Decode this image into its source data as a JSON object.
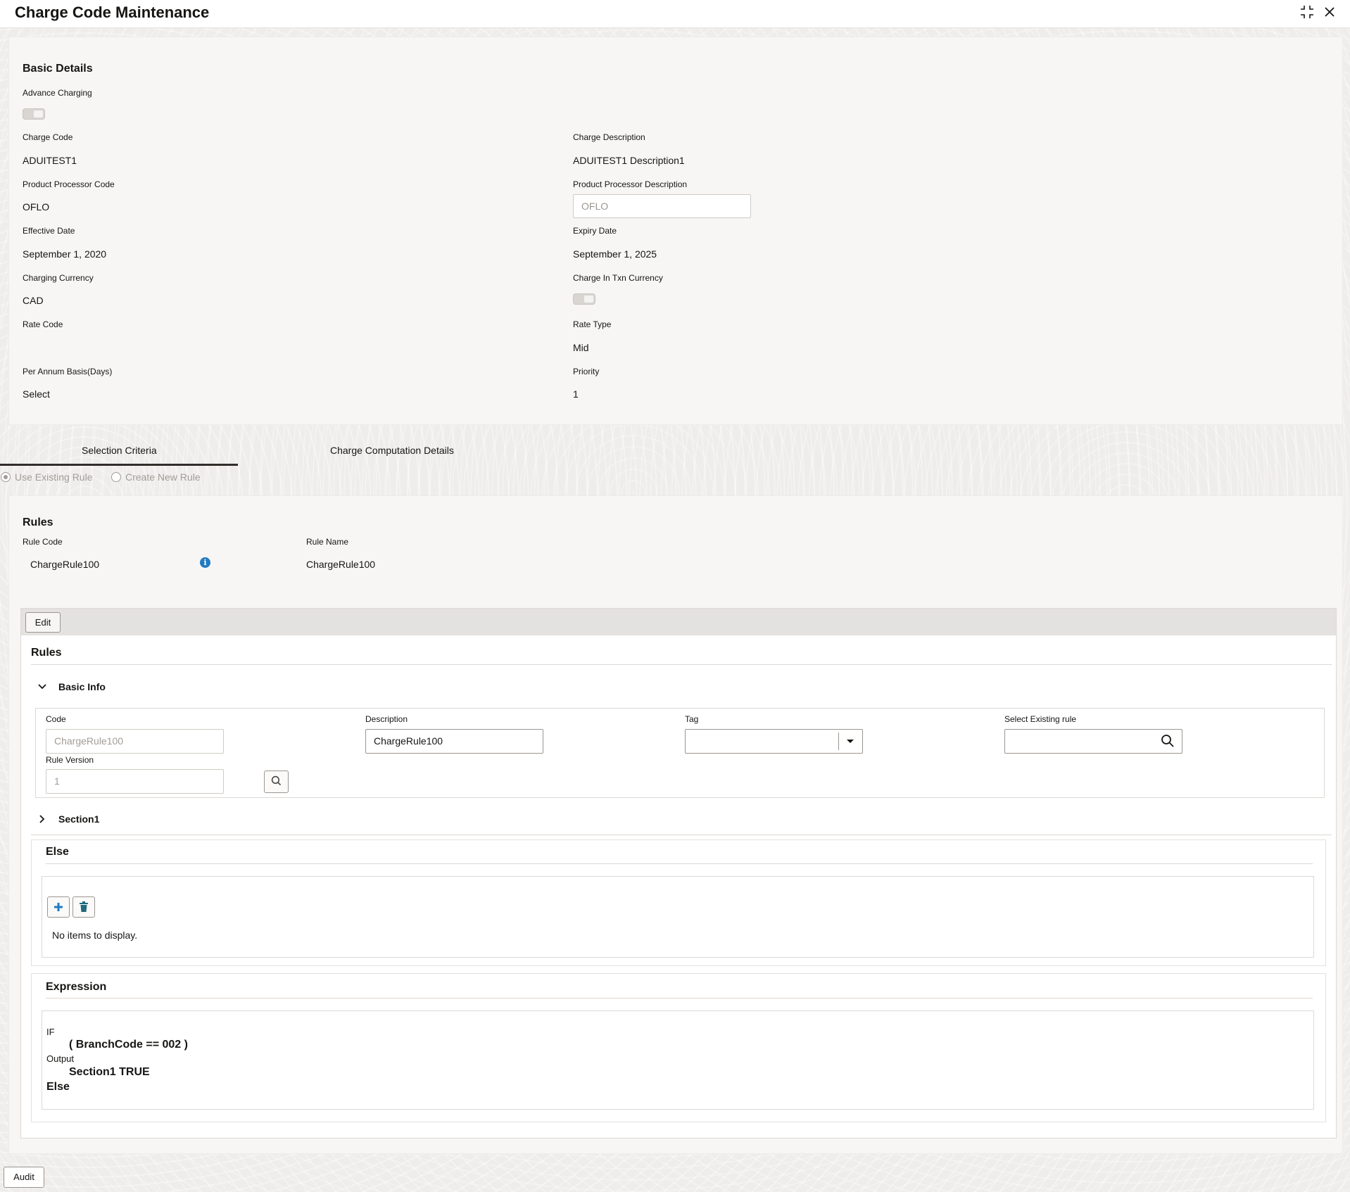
{
  "header": {
    "title": "Charge Code Maintenance",
    "minimize_icon": "collapse-icon",
    "close_icon": "close-icon"
  },
  "basic_details": {
    "title": "Basic Details",
    "advance_charging_label": "Advance Charging",
    "advance_charging_on": false,
    "charge_code_label": "Charge Code",
    "charge_code": "ADUITEST1",
    "charge_description_label": "Charge Description",
    "charge_description": "ADUITEST1 Description1",
    "product_processor_code_label": "Product Processor Code",
    "product_processor_code": "OFLO",
    "product_processor_description_label": "Product Processor Description",
    "product_processor_description": "OFLO",
    "effective_date_label": "Effective Date",
    "effective_date": "September 1, 2020",
    "expiry_date_label": "Expiry Date",
    "expiry_date": "September 1, 2025",
    "charging_currency_label": "Charging Currency",
    "charging_currency": "CAD",
    "charge_in_txn_currency_label": "Charge In Txn Currency",
    "charge_in_txn_currency_on": false,
    "rate_code_label": "Rate Code",
    "rate_code": "",
    "rate_type_label": "Rate Type",
    "rate_type": "Mid",
    "per_annum_basis_label": "Per Annum Basis(Days)",
    "per_annum_basis": "Select",
    "priority_label": "Priority",
    "priority": "1"
  },
  "tabs": [
    {
      "label": "Selection Criteria",
      "active": true
    },
    {
      "label": "Charge Computation Details",
      "active": false
    }
  ],
  "rule_mode": {
    "use_existing_label": "Use Existing Rule",
    "create_new_label": "Create New Rule",
    "selected": "use_existing"
  },
  "rules": {
    "title": "Rules",
    "rule_code_label": "Rule Code",
    "rule_code": "ChargeRule100",
    "rule_name_label": "Rule Name",
    "rule_name": "ChargeRule100",
    "info_icon": "info-icon"
  },
  "editor": {
    "edit_label": "Edit",
    "title": "Rules",
    "basic_info": {
      "title": "Basic Info",
      "code_label": "Code",
      "code_value": "ChargeRule100",
      "description_label": "Description",
      "description_value": "ChargeRule100",
      "tag_label": "Tag",
      "tag_value": "",
      "select_existing_label": "Select Existing rule",
      "select_existing_value": "",
      "rule_version_label": "Rule Version",
      "rule_version_value": "1"
    },
    "section1_label": "Section1",
    "else_section": {
      "title": "Else",
      "add_icon": "plus-icon",
      "delete_icon": "trash-icon",
      "empty_text": "No items to display."
    },
    "expression": {
      "title": "Expression",
      "if_kw": "IF",
      "condition": "( BranchCode == 002 )",
      "output_kw": "Output",
      "output_value": "Section1 TRUE",
      "else_kw": "Else"
    }
  },
  "footer": {
    "audit_label": "Audit"
  },
  "colors": {
    "accent_info": "#227ac2",
    "tab_underline": "#312d2a",
    "add_icon": "#227ac2",
    "delete_icon": "#1e6b7b"
  }
}
